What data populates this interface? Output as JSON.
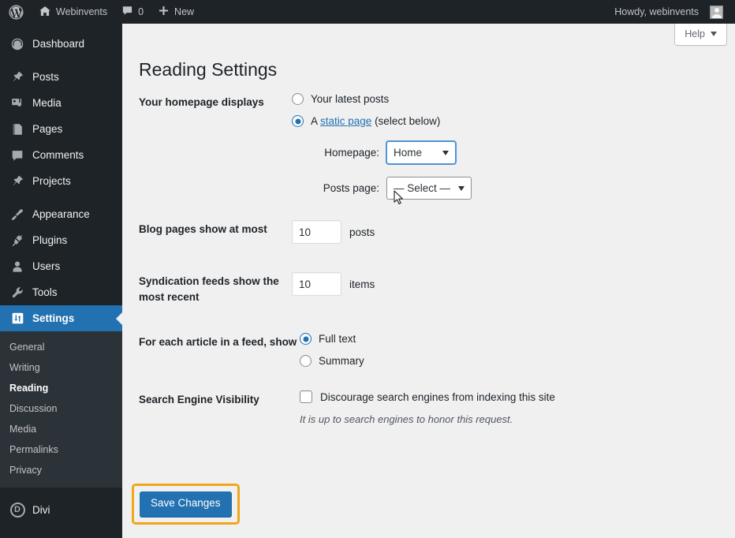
{
  "adminbar": {
    "logo_icon": "wordpress-logo-icon",
    "home_icon": "home-icon",
    "site_name": "Webinvents",
    "comments_icon": "comment-bubble-icon",
    "comments_count": "0",
    "new_icon": "plus-icon",
    "new_label": "New",
    "howdy": "Howdy, webinvents",
    "avatar_icon": "user-avatar-icon"
  },
  "sidebar": {
    "items": [
      {
        "label": "Dashboard",
        "icon": "dashboard-gauge-icon",
        "current": false
      },
      {
        "label": "Posts",
        "icon": "pin-icon",
        "current": false
      },
      {
        "label": "Media",
        "icon": "media-photo-icon",
        "current": false
      },
      {
        "label": "Pages",
        "icon": "pages-icon",
        "current": false
      },
      {
        "label": "Comments",
        "icon": "comment-bubble-icon",
        "current": false
      },
      {
        "label": "Projects",
        "icon": "pin-icon",
        "current": false
      },
      {
        "label": "Appearance",
        "icon": "paintbrush-icon",
        "current": false
      },
      {
        "label": "Plugins",
        "icon": "plug-icon",
        "current": false
      },
      {
        "label": "Users",
        "icon": "user-icon",
        "current": false
      },
      {
        "label": "Tools",
        "icon": "wrench-icon",
        "current": false
      },
      {
        "label": "Settings",
        "icon": "settings-sliders-icon",
        "current": true
      }
    ],
    "submenu": [
      {
        "label": "General",
        "current": false
      },
      {
        "label": "Writing",
        "current": false
      },
      {
        "label": "Reading",
        "current": true
      },
      {
        "label": "Discussion",
        "current": false
      },
      {
        "label": "Media",
        "current": false
      },
      {
        "label": "Permalinks",
        "current": false
      },
      {
        "label": "Privacy",
        "current": false
      }
    ],
    "divi": {
      "label": "Divi",
      "icon": "divi-d-icon"
    }
  },
  "content": {
    "help_label": "Help",
    "help_caret_icon": "chevron-down-icon",
    "page_title": "Reading Settings"
  },
  "form": {
    "homepage_displays": {
      "label": "Your homepage displays",
      "option_latest": "Your latest posts",
      "option_static_prefix": "A ",
      "option_static_link": "static page",
      "option_static_suffix": " (select below)",
      "selected": "static",
      "homepage_label": "Homepage:",
      "homepage_value": "Home",
      "homepage_focused": true,
      "posts_page_label": "Posts page:",
      "posts_page_value": "— Select —",
      "posts_page_focused": false
    },
    "blog_pages": {
      "label": "Blog pages show at most",
      "value": "10",
      "unit": "posts"
    },
    "syndication": {
      "label": "Syndication feeds show the most recent",
      "value": "10",
      "unit": "items"
    },
    "feed_article": {
      "label": "For each article in a feed, show",
      "option_full": "Full text",
      "option_summary": "Summary",
      "selected": "full"
    },
    "search_visibility": {
      "label": "Search Engine Visibility",
      "checkbox_label": "Discourage search engines from indexing this site",
      "checked": false,
      "hint": "It is up to search engines to honor this request."
    },
    "save_label": "Save Changes"
  },
  "colors": {
    "admin_dark": "#1d2327",
    "submenu_dark": "#2c3338",
    "accent_blue": "#2271b1",
    "content_bg": "#f0f0f1",
    "highlight_orange": "#f0a61b"
  }
}
